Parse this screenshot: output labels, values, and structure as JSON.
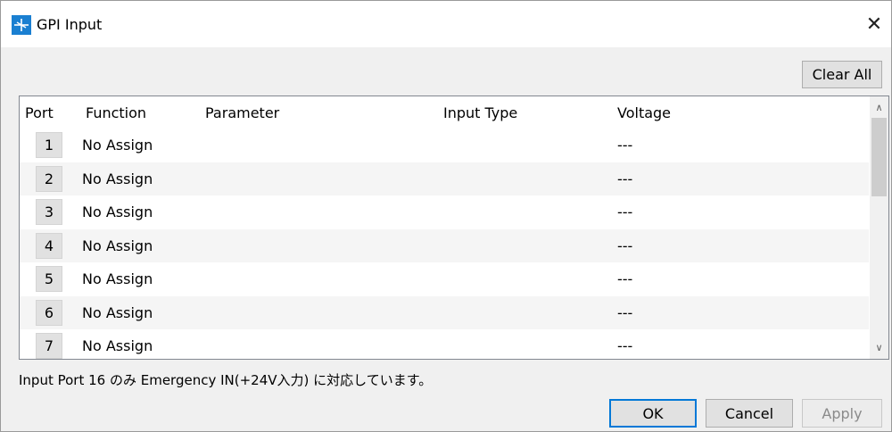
{
  "window": {
    "title": "GPI Input",
    "close_glyph": "✕",
    "icon": "app-logo-icon"
  },
  "toolbar": {
    "clear_all_label": "Clear All"
  },
  "table": {
    "headers": {
      "port": "Port",
      "function": "Function",
      "parameter": "Parameter",
      "input_type": "Input Type",
      "voltage": "Voltage"
    },
    "rows": [
      {
        "port": "1",
        "function": "No Assign",
        "parameter": "",
        "input_type": "",
        "voltage": "---"
      },
      {
        "port": "2",
        "function": "No Assign",
        "parameter": "",
        "input_type": "",
        "voltage": "---"
      },
      {
        "port": "3",
        "function": "No Assign",
        "parameter": "",
        "input_type": "",
        "voltage": "---"
      },
      {
        "port": "4",
        "function": "No Assign",
        "parameter": "",
        "input_type": "",
        "voltage": "---"
      },
      {
        "port": "5",
        "function": "No Assign",
        "parameter": "",
        "input_type": "",
        "voltage": "---"
      },
      {
        "port": "6",
        "function": "No Assign",
        "parameter": "",
        "input_type": "",
        "voltage": "---"
      },
      {
        "port": "7",
        "function": "No Assign",
        "parameter": "",
        "input_type": "",
        "voltage": "---"
      }
    ],
    "scroll_up_glyph": "∧",
    "scroll_down_glyph": "∨"
  },
  "note": "Input Port 16 のみ Emergency IN(+24V入力) に対応しています。",
  "buttons": {
    "ok": "OK",
    "cancel": "Cancel",
    "apply": "Apply"
  },
  "colors": {
    "accent": "#0078d7",
    "icon_blue": "#1a7fd1",
    "disabled_text": "#8a8a8a"
  }
}
